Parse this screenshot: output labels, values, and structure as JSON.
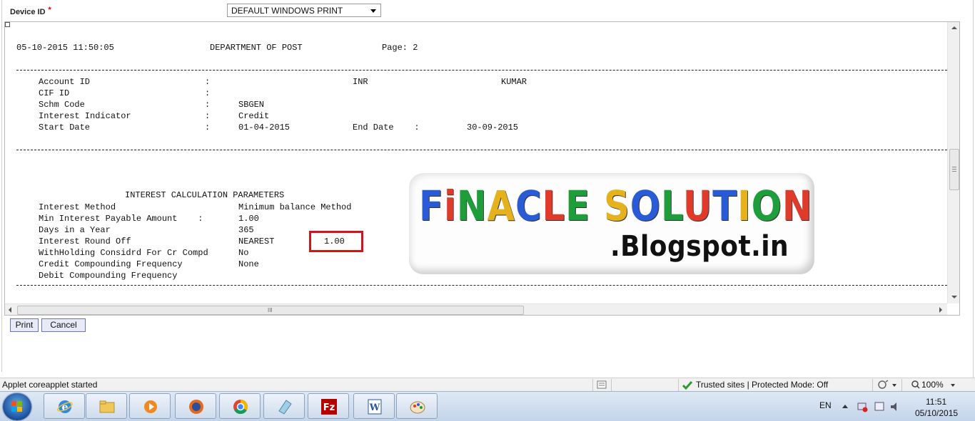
{
  "form": {
    "device_label": "Device ID",
    "required_mark": "*",
    "device_select_value": "DEFAULT WINDOWS PRINT"
  },
  "report": {
    "header_datetime": "05-10-2015 11:50:05",
    "header_department": "DEPARTMENT OF POST",
    "header_page": "Page: 2",
    "account_info": [
      {
        "label": "Account ID",
        "sep": ":",
        "value": "",
        "extra1": "INR",
        "extra2": "KUMAR"
      },
      {
        "label": "CIF ID",
        "sep": ":",
        "value": "",
        "extra1": "",
        "extra2": ""
      },
      {
        "label": "Schm Code",
        "sep": ":",
        "value": "SBGEN",
        "extra1": "",
        "extra2": ""
      },
      {
        "label": "Interest Indicator",
        "sep": ":",
        "value": "Credit",
        "extra1": "",
        "extra2": ""
      },
      {
        "label": "Start Date",
        "sep": ":",
        "value": "01-04-2015",
        "extra1": "End Date    :",
        "extra2": "30-09-2015"
      }
    ],
    "section_title": "INTEREST CALCULATION PARAMETERS",
    "params": [
      {
        "label": "Interest Method",
        "value": "Minimum balance Method"
      },
      {
        "label": "Min Interest Payable Amount    :",
        "value": "1.00"
      },
      {
        "label": "Days in a Year",
        "value": "365"
      },
      {
        "label": "Interest Round Off",
        "value": "NEAREST",
        "extra": "1.00"
      },
      {
        "label": "WithHolding Considrd For Cr Compd",
        "value": "No"
      },
      {
        "label": "Credit Compounding Frequency",
        "value": "None"
      },
      {
        "label": "Debit Compounding Frequency",
        "value": ""
      }
    ]
  },
  "logo": {
    "title_letters": [
      "F",
      "i",
      "N",
      "A",
      "C",
      "L",
      "E",
      " ",
      "S",
      "O",
      "L",
      "U",
      "T",
      "I",
      "O",
      "N"
    ],
    "title_colors": [
      "#2a5bd7",
      "#e03a2a",
      "#1e9e3a",
      "#e5b21e",
      "#2a5bd7",
      "#e03a2a",
      "#1e9e3a",
      "#ffffff",
      "#e5b21e",
      "#2a5bd7",
      "#1e9e3a",
      "#e03a2a",
      "#2a5bd7",
      "#e5b21e",
      "#1e9e3a",
      "#e03a2a"
    ],
    "subtitle": ".Blogspot.in"
  },
  "buttons": {
    "print": "Print",
    "cancel": "Cancel"
  },
  "scrollbar": {
    "h_grip": "III"
  },
  "statusbar": {
    "message": "Applet coreapplet started",
    "zone": "Trusted sites | Protected Mode: Off",
    "zoom": "100%"
  },
  "taskbar": {
    "apps": [
      "Internet Explorer",
      "Windows Explorer",
      "Media Player",
      "Firefox",
      "Chrome",
      "Notepad",
      "FileZilla",
      "Word",
      "Paint"
    ],
    "filezilla_glyph": "Fz",
    "word_glyph": "W",
    "language": "EN",
    "time": "11:51",
    "date": "05/10/2015"
  },
  "colors": {
    "highlight_box": "#d4141c",
    "button_border": "#6a72b8"
  }
}
